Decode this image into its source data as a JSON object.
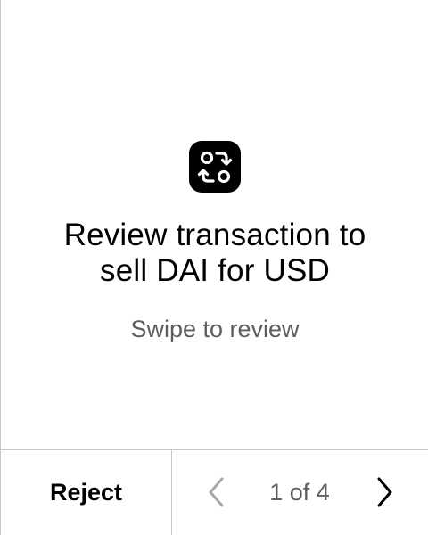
{
  "review": {
    "icon": "swap-arrows-icon",
    "title_line1": "Review transaction to",
    "title_line2": "sell DAI for USD",
    "hint": "Swipe to review"
  },
  "footer": {
    "reject_label": "Reject",
    "pager": {
      "prev_icon": "chevron-left-icon",
      "next_icon": "chevron-right-icon",
      "label": "1 of 4"
    }
  },
  "colors": {
    "text": "#000000",
    "secondary_text": "#5e5e5e",
    "disabled_icon": "#a8a8a8",
    "divider": "#c8c8c8",
    "background": "#ffffff"
  }
}
